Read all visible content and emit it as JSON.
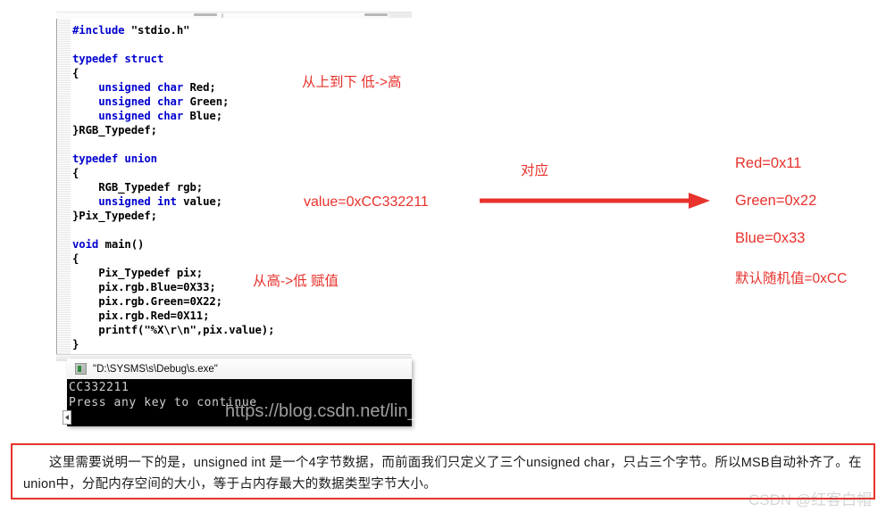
{
  "ide": {
    "code_lines": [
      {
        "indent": 0,
        "parts": [
          {
            "t": "#include",
            "c": "kw"
          },
          {
            "t": " \"stdio.h\"",
            "c": "pl"
          }
        ]
      },
      {
        "indent": 0,
        "parts": []
      },
      {
        "indent": 0,
        "parts": [
          {
            "t": "typedef struct",
            "c": "kw"
          }
        ]
      },
      {
        "indent": 0,
        "parts": [
          {
            "t": "{",
            "c": "pl"
          }
        ]
      },
      {
        "indent": 4,
        "parts": [
          {
            "t": "unsigned char",
            "c": "kw"
          },
          {
            "t": " Red;",
            "c": "pl"
          }
        ]
      },
      {
        "indent": 4,
        "parts": [
          {
            "t": "unsigned char",
            "c": "kw"
          },
          {
            "t": " Green;",
            "c": "pl"
          }
        ]
      },
      {
        "indent": 4,
        "parts": [
          {
            "t": "unsigned char",
            "c": "kw"
          },
          {
            "t": " Blue;",
            "c": "pl"
          }
        ]
      },
      {
        "indent": 0,
        "parts": [
          {
            "t": "}RGB_Typedef;",
            "c": "pl"
          }
        ]
      },
      {
        "indent": 0,
        "parts": []
      },
      {
        "indent": 0,
        "parts": [
          {
            "t": "typedef union",
            "c": "kw"
          }
        ]
      },
      {
        "indent": 0,
        "parts": [
          {
            "t": "{",
            "c": "pl"
          }
        ]
      },
      {
        "indent": 4,
        "parts": [
          {
            "t": "RGB_Typedef rgb;",
            "c": "pl"
          }
        ]
      },
      {
        "indent": 4,
        "parts": [
          {
            "t": "unsigned int",
            "c": "kw"
          },
          {
            "t": " value;",
            "c": "pl"
          }
        ]
      },
      {
        "indent": 0,
        "parts": [
          {
            "t": "}Pix_Typedef;",
            "c": "pl"
          }
        ]
      },
      {
        "indent": 0,
        "parts": []
      },
      {
        "indent": 0,
        "parts": [
          {
            "t": "void",
            "c": "kw"
          },
          {
            "t": " main()",
            "c": "pl"
          }
        ]
      },
      {
        "indent": 0,
        "parts": [
          {
            "t": "{",
            "c": "pl"
          }
        ]
      },
      {
        "indent": 4,
        "parts": [
          {
            "t": "Pix_Typedef pix;",
            "c": "pl"
          }
        ]
      },
      {
        "indent": 4,
        "parts": [
          {
            "t": "pix.rgb.Blue=0X33;",
            "c": "pl"
          }
        ]
      },
      {
        "indent": 4,
        "parts": [
          {
            "t": "pix.rgb.Green=0X22;",
            "c": "pl"
          }
        ]
      },
      {
        "indent": 4,
        "parts": [
          {
            "t": "pix.rgb.Red=0X11;",
            "c": "pl"
          }
        ]
      },
      {
        "indent": 4,
        "parts": [
          {
            "t": "printf(\"%X\\r\\n\",pix.value);",
            "c": "pl"
          }
        ]
      },
      {
        "indent": 0,
        "parts": [
          {
            "t": "}",
            "c": "pl"
          }
        ]
      }
    ]
  },
  "console": {
    "title": "\"D:\\SYSMS\\s\\Debug\\s.exe\"",
    "output_line_1": "CC332211",
    "output_line_2": "Press any key to continue"
  },
  "annotations": {
    "top_to_bottom": "从上到下  低->高",
    "value_expr": "value=0xCC332211",
    "high_to_low": "从高->低   赋值",
    "correspond": "对应",
    "red": "Red=0x11",
    "green": "Green=0x22",
    "blue": "Blue=0x33",
    "msb_default": "默认随机值=0xCC"
  },
  "note": {
    "text": "这里需要说明一下的是，unsigned int 是一个4字节数据，而前面我们只定义了三个unsigned char，只占三个字节。所以MSB自动补齐了。在union中，分配内存空间的大小，等于占内存最大的数据类型字节大小。"
  },
  "watermarks": {
    "console_url": "https://blog.csdn.net/lin_duo",
    "bottom_credit": "CSDN @红客白帽"
  },
  "colors": {
    "annotation_red": "#e8322c",
    "keyword_blue": "#0000d0",
    "console_bg": "#000000",
    "console_fg": "#cfcfcf"
  }
}
